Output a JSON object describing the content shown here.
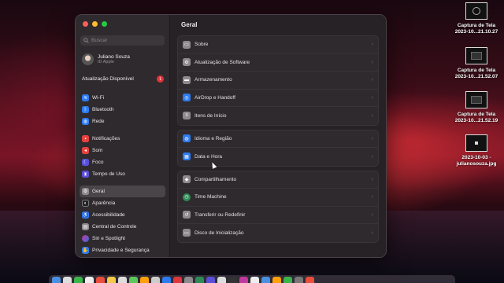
{
  "desktop": {
    "files": [
      {
        "line1": "Captura de Tela",
        "line2": "2023-10...21.10.27"
      },
      {
        "line1": "Captura de Tela",
        "line2": "2023-10...21.52.07"
      },
      {
        "line1": "Captura de Tela",
        "line2": "2023-10...21.52.19"
      },
      {
        "line1": "2023-10-03 -",
        "line2": "julianosouza.jpg"
      }
    ]
  },
  "sidebar": {
    "search_placeholder": "Buscar",
    "user": {
      "name": "Juliano Souza",
      "subtitle": "ID Apple"
    },
    "update": {
      "label": "Atualização Disponível",
      "count": "1"
    },
    "items": [
      {
        "label": "Wi-Fi",
        "icon": "wifi-icon",
        "color": "#2d7bf0"
      },
      {
        "label": "Bluetooth",
        "icon": "bluetooth-icon",
        "color": "#2d7bf0"
      },
      {
        "label": "Rede",
        "icon": "globe-icon",
        "color": "#2d7bf0"
      },
      {
        "label": "Notificações",
        "icon": "bell-icon",
        "color": "#e5423f"
      },
      {
        "label": "Som",
        "icon": "speaker-icon",
        "color": "#e5423f"
      },
      {
        "label": "Foco",
        "icon": "moon-icon",
        "color": "#5a4fd8"
      },
      {
        "label": "Tempo de Uso",
        "icon": "hourglass-icon",
        "color": "#5a4fd8"
      },
      {
        "label": "Geral",
        "icon": "gear-icon",
        "color": "#8e8a8d"
      },
      {
        "label": "Aparência",
        "icon": "appearance-icon",
        "color": "#222222"
      },
      {
        "label": "Acessibilidade",
        "icon": "accessibility-icon",
        "color": "#2d7bf0"
      },
      {
        "label": "Central de Controle",
        "icon": "control-center-icon",
        "color": "#8e8a8d"
      },
      {
        "label": "Siri e Spotlight",
        "icon": "siri-icon",
        "color": "#c0399d"
      },
      {
        "label": "Privacidade e Segurança",
        "icon": "hand-icon",
        "color": "#2d7bf0"
      }
    ]
  },
  "main": {
    "title": "Geral",
    "groups": [
      [
        {
          "label": "Sobre",
          "icon": "info-icon",
          "color": "#8e8a8d"
        },
        {
          "label": "Atualização de Software",
          "icon": "gear-badge-icon",
          "color": "#8e8a8d"
        },
        {
          "label": "Armazenamento",
          "icon": "drive-icon",
          "color": "#8e8a8d"
        },
        {
          "label": "AirDrop e Handoff",
          "icon": "airdrop-icon",
          "color": "#2d7bf0"
        },
        {
          "label": "Itens de Início",
          "icon": "list-icon",
          "color": "#8e8a8d"
        }
      ],
      [
        {
          "label": "Idioma e Região",
          "icon": "globe-flag-icon",
          "color": "#2d7bf0"
        },
        {
          "label": "Data e Hora",
          "icon": "calendar-clock-icon",
          "color": "#2d7bf0"
        }
      ],
      [
        {
          "label": "Compartilhamento",
          "icon": "share-icon",
          "color": "#8e8a8d"
        },
        {
          "label": "Time Machine",
          "icon": "time-machine-icon",
          "color": "#2e8b57"
        },
        {
          "label": "Transferir ou Redefinir",
          "icon": "reset-icon",
          "color": "#8e8a8d"
        },
        {
          "label": "Disco de Inicialização",
          "icon": "disk-icon",
          "color": "#8e8a8d"
        }
      ]
    ]
  },
  "colors": {
    "accent": "#2d7bf0",
    "close": "#fe5f57",
    "minimize": "#febc2e",
    "zoom": "#28c840"
  }
}
